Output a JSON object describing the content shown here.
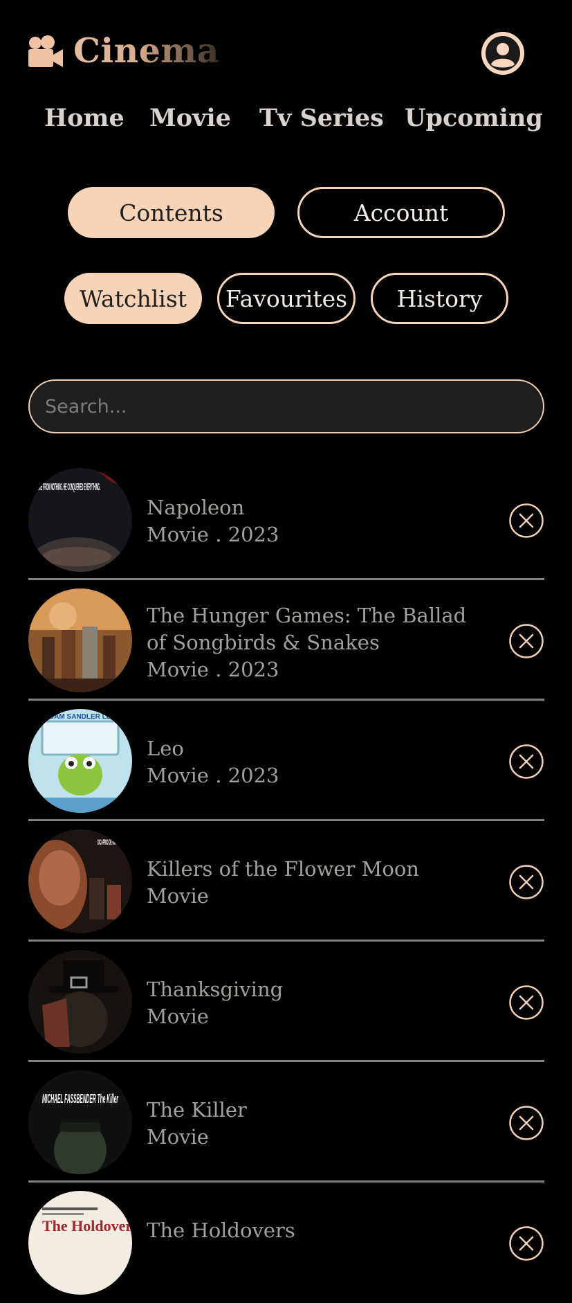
{
  "app": {
    "title": "Cinema"
  },
  "icons": {
    "logo": "video-camera-icon",
    "profile": "user-circle-icon",
    "remove": "circle-x-icon"
  },
  "colors": {
    "accent": "#f7d3b8",
    "background": "#000000",
    "search_bg": "#1f1f1f",
    "divider": "#7f7f7f"
  },
  "nav": {
    "items": [
      {
        "label": "Home"
      },
      {
        "label": "Movie"
      },
      {
        "label": "Tv Series"
      },
      {
        "label": "Upcoming"
      }
    ]
  },
  "section_tabs": {
    "contents": "Contents",
    "account": "Account",
    "active": "Contents"
  },
  "list_tabs": {
    "watchlist": "Watchlist",
    "favourites": "Favourites",
    "history": "History",
    "active": "Watchlist"
  },
  "search": {
    "placeholder": "Search...",
    "value": ""
  },
  "watchlist": [
    {
      "title": "Napoleon",
      "meta": "Movie . 2023",
      "poster_text": "HE CAME FROM NOTHING. HE CONQUERED EVERYTHING."
    },
    {
      "title": "The Hunger Games: The Ballad of Songbirds & Snakes",
      "meta": "Movie . 2023",
      "poster_text": ""
    },
    {
      "title": "Leo",
      "meta": "Movie . 2023",
      "poster_text": "ADAM SANDLER LEO"
    },
    {
      "title": "Killers of the Flower Moon",
      "meta": "Movie",
      "poster_text": "DICAPRIO DE NIRO GLADSTONE"
    },
    {
      "title": "Thanksgiving",
      "meta": "Movie",
      "poster_text": ""
    },
    {
      "title": "The Killer",
      "meta": "Movie",
      "poster_text": "MICHAEL FASSBENDER The Killer"
    },
    {
      "title": "The Holdovers",
      "meta": "",
      "poster_text": "The Holdovers"
    }
  ]
}
